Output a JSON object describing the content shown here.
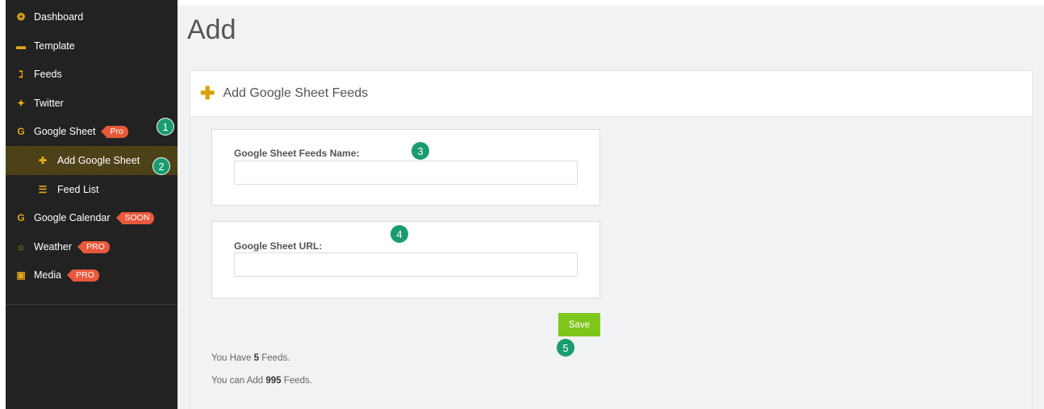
{
  "sidebar": {
    "items": [
      {
        "label": "Dashboard",
        "icon": "dashboard-icon",
        "glyph": "❂"
      },
      {
        "label": "Template",
        "icon": "template-icon",
        "glyph": "▬"
      },
      {
        "label": "Feeds",
        "icon": "rss-icon",
        "glyph": "ℷ"
      },
      {
        "label": "Twitter",
        "icon": "twitter-icon",
        "glyph": "✦"
      },
      {
        "label": "Google Sheet",
        "icon": "google-icon",
        "glyph": "G",
        "badge": "Pro"
      },
      {
        "label": "Add Google Sheet",
        "icon": "plus-icon",
        "glyph": "✚",
        "active": true
      },
      {
        "label": "Feed List",
        "icon": "list-icon",
        "glyph": "☰"
      },
      {
        "label": "Google Calendar",
        "icon": "google-icon",
        "glyph": "G",
        "badge": "SOON"
      },
      {
        "label": "Weather",
        "icon": "sun-icon",
        "glyph": "☼",
        "badge": "PRO"
      },
      {
        "label": "Media",
        "icon": "image-icon",
        "glyph": "▣",
        "badge": "PRO"
      }
    ]
  },
  "steps": [
    "1",
    "2",
    "3",
    "4",
    "5"
  ],
  "page": {
    "title": "Add",
    "panel_title": "Add Google Sheet Feeds"
  },
  "form": {
    "name_label": "Google Sheet Feeds Name:",
    "name_value": "",
    "url_label": "Google Sheet URL:",
    "url_value": "",
    "save_label": "Save"
  },
  "stats": {
    "have_prefix": "You Have ",
    "have_count": "5",
    "have_suffix": " Feeds.",
    "can_prefix": "You can Add ",
    "can_count": "995",
    "can_suffix": " Feeds."
  },
  "colors": {
    "sidebar_bg": "#222222",
    "accent_icon": "#e6a817",
    "badge": "#e8583a",
    "step_marker": "#1a9c6f",
    "save_button": "#7ec61b"
  }
}
